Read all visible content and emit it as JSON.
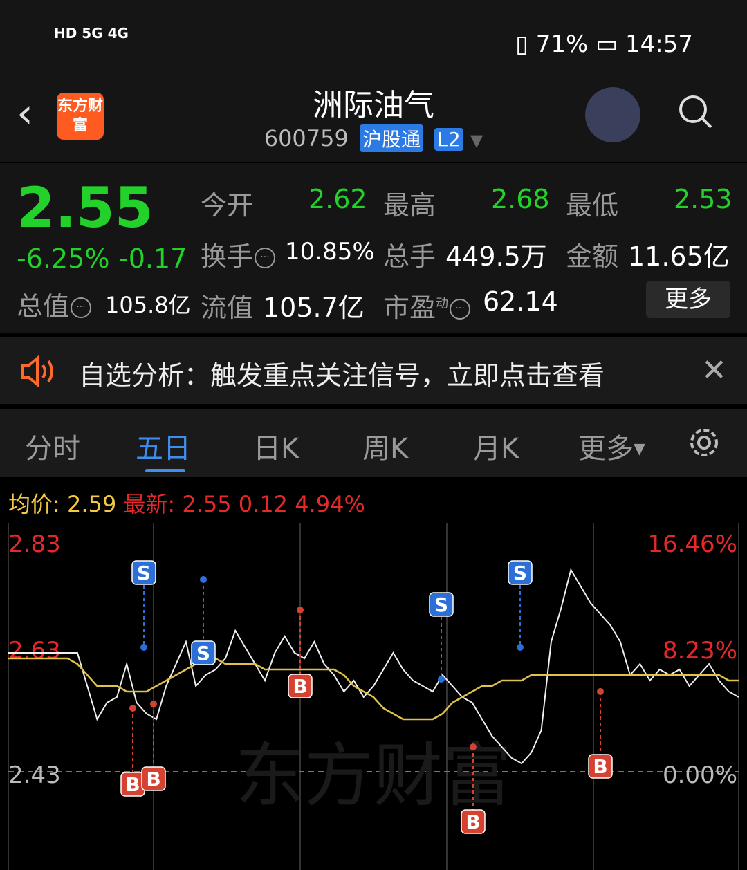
{
  "status": {
    "left_text": "HD 5G 4G",
    "battery": "71%",
    "time": "14:57"
  },
  "header": {
    "back_icon": "chevron-left-icon",
    "logo_text": "东方财富",
    "title": "洲际油气",
    "code": "600759",
    "tag1": "沪股通",
    "tag2": "L2"
  },
  "quote": {
    "price": "2.55",
    "change_pct": "-6.25%",
    "change": "-0.17",
    "total_value_label": "总值",
    "total_value": "105.8亿",
    "open_label": "今开",
    "open": "2.62",
    "high_label": "最高",
    "high": "2.68",
    "low_label": "最低",
    "low": "2.53",
    "turnover_label": "换手",
    "turnover": "10.85%",
    "volume_label": "总手",
    "volume": "449.5万",
    "amount_label": "金额",
    "amount": "11.65亿",
    "float_label": "流值",
    "float_value": "105.7亿",
    "pe_label": "市盈",
    "pe_sup": "动",
    "pe": "62.14",
    "more": "更多"
  },
  "notice": {
    "text": "自选分析：触发重点关注信号，立即点击查看"
  },
  "tabs": [
    "分时",
    "五日",
    "日K",
    "周K",
    "月K",
    "更多"
  ],
  "chart_header": {
    "avg_label": "均价:",
    "avg_value": "2.59",
    "latest_label": "最新:",
    "latest_value": "2.55",
    "latest_change": "0.12",
    "latest_pct": "4.94%"
  },
  "chart_data": {
    "type": "line",
    "y_left_ticks": [
      "2.83",
      "2.63",
      "2.43"
    ],
    "y_right_ticks": [
      "16.46%",
      "8.23%",
      "0.00%"
    ],
    "ylim": [
      2.4,
      2.85
    ],
    "series": [
      {
        "values": [
          2.64,
          2.64,
          2.64,
          2.64,
          2.64,
          2.64,
          2.64,
          2.64,
          2.58,
          2.52,
          2.55,
          2.56,
          2.62,
          2.55,
          2.53,
          2.52,
          2.58,
          2.62,
          2.66,
          2.58,
          2.6,
          2.61,
          2.63,
          2.68,
          2.65,
          2.62,
          2.59,
          2.64,
          2.67,
          2.64,
          2.63,
          2.66,
          2.62,
          2.6,
          2.57,
          2.59,
          2.56,
          2.58,
          2.61,
          2.64,
          2.61,
          2.59,
          2.58,
          2.57,
          2.6,
          2.58,
          2.56,
          2.55,
          2.52,
          2.49,
          2.47,
          2.45,
          2.44,
          2.46,
          2.5,
          2.66,
          2.72,
          2.79,
          2.76,
          2.73,
          2.71,
          2.69,
          2.66,
          2.6,
          2.62,
          2.59,
          2.61,
          2.6,
          2.61,
          2.58,
          2.6,
          2.62,
          2.59,
          2.57,
          2.56
        ]
      },
      {
        "values": [
          2.63,
          2.63,
          2.63,
          2.63,
          2.63,
          2.63,
          2.63,
          2.62,
          2.6,
          2.58,
          2.58,
          2.58,
          2.57,
          2.57,
          2.57,
          2.58,
          2.59,
          2.6,
          2.61,
          2.62,
          2.64,
          2.63,
          2.62,
          2.62,
          2.62,
          2.62,
          2.61,
          2.61,
          2.61,
          2.61,
          2.61,
          2.61,
          2.61,
          2.61,
          2.6,
          2.58,
          2.57,
          2.56,
          2.54,
          2.53,
          2.52,
          2.52,
          2.52,
          2.52,
          2.53,
          2.55,
          2.56,
          2.57,
          2.58,
          2.58,
          2.59,
          2.59,
          2.59,
          2.6,
          2.6,
          2.6,
          2.6,
          2.6,
          2.6,
          2.6,
          2.6,
          2.6,
          2.6,
          2.6,
          2.6,
          2.6,
          2.6,
          2.6,
          2.6,
          2.6,
          2.6,
          2.6,
          2.6,
          2.59,
          2.59
        ]
      }
    ],
    "signals": [
      "S",
      "S",
      "S",
      "S",
      "B",
      "B",
      "B",
      "B",
      "B",
      "B"
    ]
  }
}
